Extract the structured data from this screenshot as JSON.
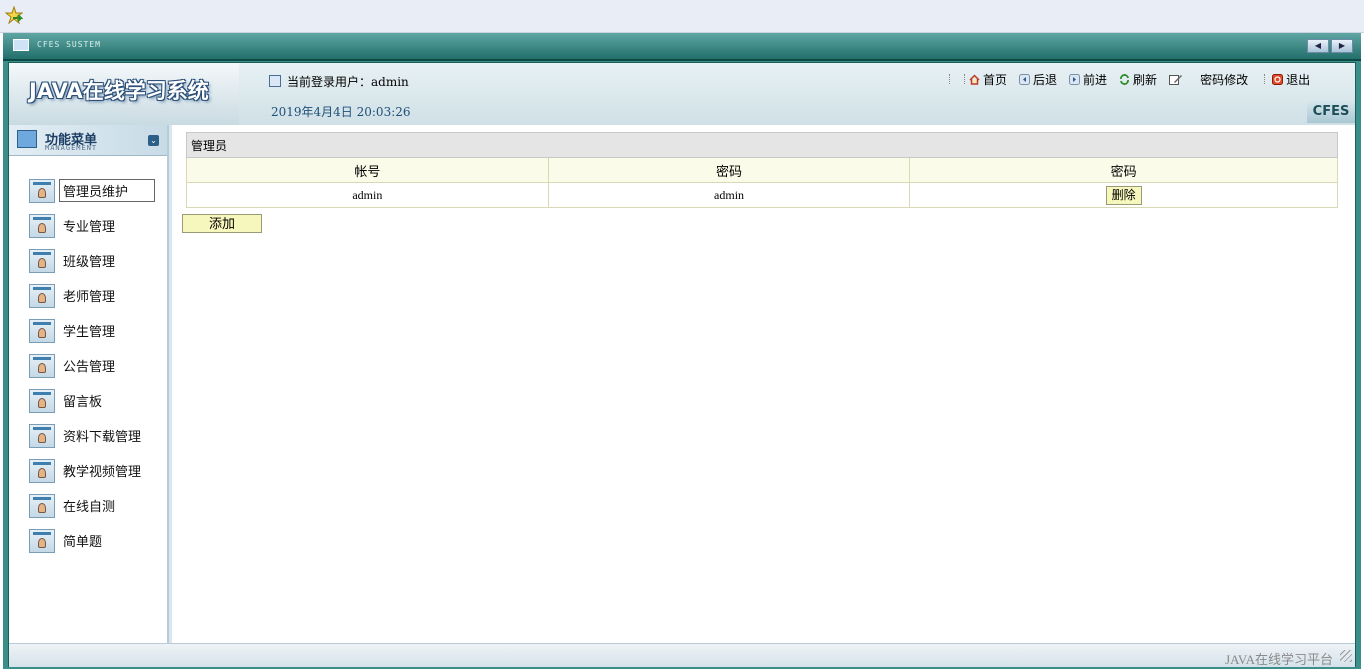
{
  "window": {
    "system_label": "CFES SUSTEM"
  },
  "header": {
    "app_title": "JAVA在线学习系统",
    "user_label": "当前登录用户：admin",
    "datetime": "2019年4月4日  20:03:26",
    "brand": "CFES"
  },
  "toolbar": {
    "home": "首页",
    "back": "后退",
    "forward": "前进",
    "refresh": "刷新",
    "change_password": "密码修改",
    "logout": "退出"
  },
  "sidebar": {
    "title": "功能菜单",
    "subtitle": "MANAGEMENT",
    "items": [
      {
        "label": "管理员维护"
      },
      {
        "label": "专业管理"
      },
      {
        "label": "班级管理"
      },
      {
        "label": "老师管理"
      },
      {
        "label": "学生管理"
      },
      {
        "label": "公告管理"
      },
      {
        "label": "留言板"
      },
      {
        "label": "资料下载管理"
      },
      {
        "label": "教学视频管理"
      },
      {
        "label": "在线自测"
      },
      {
        "label": "简单题"
      }
    ]
  },
  "main": {
    "caption": "管理员",
    "columns": [
      "帐号",
      "密码",
      "密码"
    ],
    "rows": [
      {
        "account": "admin",
        "password": "admin",
        "action": "删除"
      }
    ],
    "add_button": "添加"
  },
  "footer": {
    "text": "JAVA在线学习平台"
  },
  "colors": {
    "frame": "#3b8f8a",
    "button_bg": "#f6f7bd",
    "header_row_bg": "#fbfbe9"
  }
}
